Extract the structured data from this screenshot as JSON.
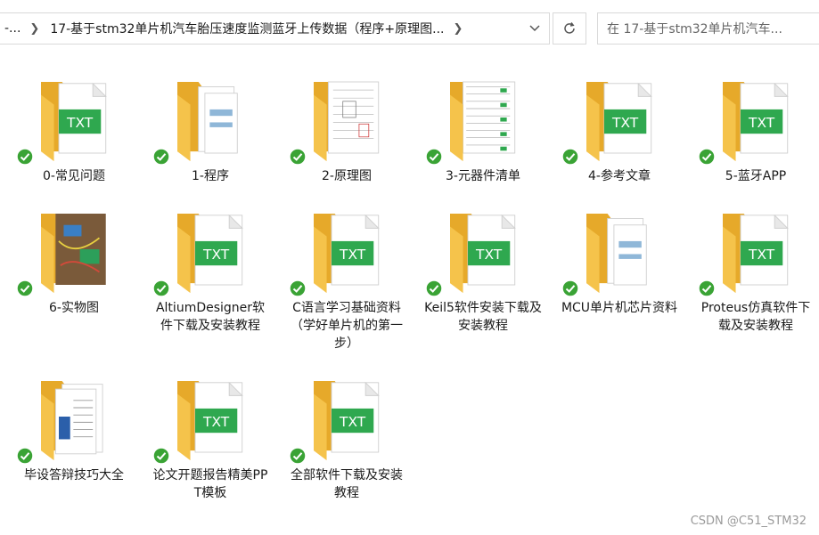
{
  "address_bar": {
    "prev_crumb": "-...",
    "current_folder": "17-基于stm32单片机汽车胎压速度监测蓝牙上传数据（程序+原理图..."
  },
  "search": {
    "placeholder": "在 17-基于stm32单片机汽车..."
  },
  "icons": {
    "chevron": "chevron-right-icon",
    "dropdown": "chevron-down-icon",
    "refresh": "refresh-icon",
    "sync_status": "green-check-icon"
  },
  "colors": {
    "folder": "#f5c34b",
    "folder_dark": "#e6a92a",
    "txt_badge": "#2fa84f",
    "check": "#3aa335"
  },
  "items": [
    {
      "name": "0-常见问题",
      "kind": "txt"
    },
    {
      "name": "1-程序",
      "kind": "docs"
    },
    {
      "name": "2-原理图",
      "kind": "schematic"
    },
    {
      "name": "3-元器件清单",
      "kind": "list"
    },
    {
      "name": "4-参考文章",
      "kind": "txt"
    },
    {
      "name": "5-蓝牙APP",
      "kind": "txt"
    },
    {
      "name": "6-实物图",
      "kind": "photo"
    },
    {
      "name": "AltiumDesigner软件下载及安装教程",
      "kind": "txt"
    },
    {
      "name": "C语言学习基础资料（学好单片机的第一步）",
      "kind": "txt"
    },
    {
      "name": "Keil5软件安装下载及安装教程",
      "kind": "txt"
    },
    {
      "name": "MCU单片机芯片资料",
      "kind": "docs"
    },
    {
      "name": "Proteus仿真软件下载及安装教程",
      "kind": "txt"
    },
    {
      "name": "毕设答辩技巧大全",
      "kind": "word"
    },
    {
      "name": "论文开题报告精美PPT模板",
      "kind": "txt"
    },
    {
      "name": "全部软件下载及安装教程",
      "kind": "txt"
    }
  ],
  "watermark": "CSDN @C51_STM32"
}
